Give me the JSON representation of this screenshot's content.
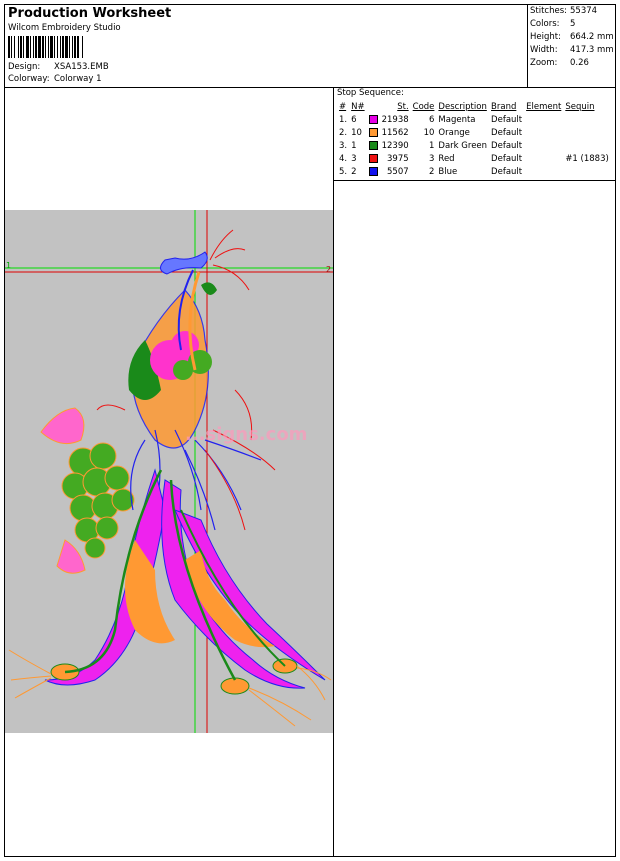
{
  "header": {
    "title": "Production Worksheet",
    "software": "Wilcom Embroidery Studio",
    "design_label": "Design:",
    "design_value": "XSA153.EMB",
    "colorway_label": "Colorway:",
    "colorway_value": "Colorway 1"
  },
  "stats": [
    {
      "label": "Stitches:",
      "value": "55374"
    },
    {
      "label": "Colors:",
      "value": "5"
    },
    {
      "label": "Height:",
      "value": "664.2 mm"
    },
    {
      "label": "Width:",
      "value": "417.3 mm"
    },
    {
      "label": "Zoom:",
      "value": "0.26"
    }
  ],
  "stop_sequence": {
    "title": "Stop Sequence:",
    "headers": [
      "#",
      "N#",
      "St.",
      "Code",
      "Description",
      "Brand",
      "Element",
      "Sequin"
    ],
    "rows": [
      {
        "num": "1.",
        "n": "6",
        "color": "#e600e6",
        "st": "21938",
        "code": "6",
        "desc": "Magenta",
        "brand": "Default",
        "element": "",
        "sequin": ""
      },
      {
        "num": "2.",
        "n": "10",
        "color": "#ff9933",
        "st": "11562",
        "code": "10",
        "desc": "Orange",
        "brand": "Default",
        "element": "",
        "sequin": ""
      },
      {
        "num": "3.",
        "n": "1",
        "color": "#1a8a1a",
        "st": "12390",
        "code": "1",
        "desc": "Dark Green",
        "brand": "Default",
        "element": "",
        "sequin": ""
      },
      {
        "num": "4.",
        "n": "3",
        "color": "#ee1111",
        "st": "3975",
        "code": "3",
        "desc": "Red",
        "brand": "Default",
        "element": "",
        "sequin": "#1 (1883)"
      },
      {
        "num": "5.",
        "n": "2",
        "color": "#1111ee",
        "st": "5507",
        "code": "2",
        "desc": "Blue",
        "brand": "Default",
        "element": "",
        "sequin": ""
      }
    ]
  },
  "preview": {
    "watermark": "...signs.com",
    "marker_left": "1",
    "marker_right": "2"
  }
}
